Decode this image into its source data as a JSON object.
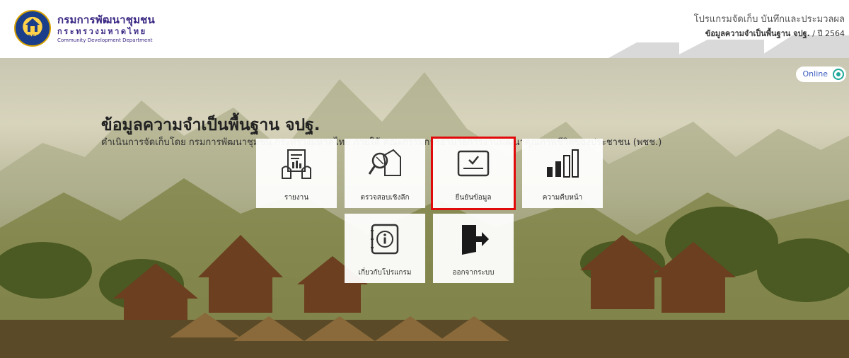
{
  "header": {
    "org_name_th": "กรมการพัฒนาชุมชน",
    "org_ministry_th": "กระทรวงมหาดไทย",
    "org_name_en": "Community Development Department",
    "logo_year": "ปี 2564",
    "program_title": "โปรแกรมจัดเก็บ บันทึกและประมวลผล",
    "program_subtitle_bold": "ข้อมูลความจำเป็นพื้นฐาน จปฐ.",
    "program_subtitle_year": " / ปี 2564"
  },
  "status": {
    "label": "Online"
  },
  "hero": {
    "title": "ข้อมูลความจำเป็นพื้นฐาน จปฐ.",
    "description": "ดำเนินการจัดเก็บโดย กรมการพัฒนาชุมชน กระทรวงมหาดไทย ภายใต้ คณะกรรมการอำนวยการงานพัฒนาคุณภาพชีวิตของประชาชน (พชช.)"
  },
  "menu": [
    {
      "label": "รายงาน",
      "icon": "report-icon"
    },
    {
      "label": "ตรวจสอบเชิงลึก",
      "icon": "inspect-house-icon"
    },
    {
      "label": "ยืนยันข้อมูล",
      "icon": "confirm-data-icon",
      "selected": true
    },
    {
      "label": "ความคืบหน้า",
      "icon": "progress-bars-icon"
    },
    {
      "label": "เกี่ยวกับโปรแกรม",
      "icon": "info-icon"
    },
    {
      "label": "ออกจากระบบ",
      "icon": "logout-icon"
    }
  ],
  "colors": {
    "brand": "#3b2783",
    "selected_outline": "#e10a0a",
    "online": "#1fa89a"
  }
}
